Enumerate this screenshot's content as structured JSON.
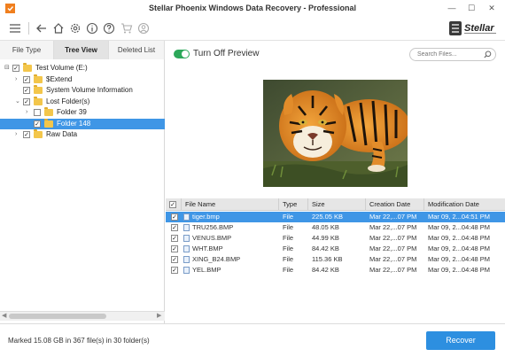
{
  "window": {
    "title": "Stellar Phoenix Windows Data Recovery - Professional",
    "minimize": "—",
    "maximize": "☐",
    "close": "✕"
  },
  "toolbar": {
    "icons": [
      "menu-icon",
      "back-icon",
      "home-icon",
      "gear-icon",
      "info-icon",
      "help-icon",
      "cart-icon",
      "user-icon"
    ],
    "brand_text": "Stellar"
  },
  "left_panel": {
    "tabs": [
      "File Type",
      "Tree View",
      "Deleted List"
    ],
    "active_tab": 1,
    "tree": [
      {
        "label": "Test Volume (E:)",
        "exp": "⊟",
        "checked": true,
        "level": 0
      },
      {
        "label": "$Extend",
        "exp": "›",
        "checked": true,
        "level": 1
      },
      {
        "label": "System Volume Information",
        "exp": "",
        "checked": true,
        "level": 1
      },
      {
        "label": "Lost Folder(s)",
        "exp": "⌄",
        "checked": true,
        "level": 1
      },
      {
        "label": "Folder 39",
        "exp": "›",
        "checked": false,
        "level": 2
      },
      {
        "label": "Folder 148",
        "exp": "",
        "checked": true,
        "level": 2,
        "selected": true
      },
      {
        "label": "Raw Data",
        "exp": "›",
        "checked": true,
        "level": 1
      }
    ]
  },
  "right_panel": {
    "toggle_label": "Turn Off Preview",
    "search_placeholder": "Search Files...",
    "table": {
      "columns": [
        "File Name",
        "Type",
        "Size",
        "Creation Date",
        "Modification Date"
      ],
      "rows": [
        {
          "name": "tiger.bmp",
          "type": "File",
          "size": "225.05 KB",
          "created": "Mar 22,...07 PM",
          "modified": "Mar 09, 2...04:51 PM",
          "selected": true
        },
        {
          "name": "TRU256.BMP",
          "type": "File",
          "size": "48.05 KB",
          "created": "Mar 22,...07 PM",
          "modified": "Mar 09, 2...04:48 PM"
        },
        {
          "name": "VENUS.BMP",
          "type": "File",
          "size": "44.99 KB",
          "created": "Mar 22,...07 PM",
          "modified": "Mar 09, 2...04:48 PM"
        },
        {
          "name": "WHT.BMP",
          "type": "File",
          "size": "84.42 KB",
          "created": "Mar 22,...07 PM",
          "modified": "Mar 09, 2...04:48 PM"
        },
        {
          "name": "XING_B24.BMP",
          "type": "File",
          "size": "115.36 KB",
          "created": "Mar 22,...07 PM",
          "modified": "Mar 09, 2...04:48 PM"
        },
        {
          "name": "YEL.BMP",
          "type": "File",
          "size": "84.42 KB",
          "created": "Mar 22,...07 PM",
          "modified": "Mar 09, 2...04:48 PM"
        }
      ]
    }
  },
  "status": {
    "text": "Marked 15.08 GB in 367 file(s) in 30 folder(s)",
    "recover_label": "Recover"
  },
  "colors": {
    "accent": "#2d8fe0",
    "selection": "#3f96e6",
    "toggle_on": "#2ca85a"
  }
}
